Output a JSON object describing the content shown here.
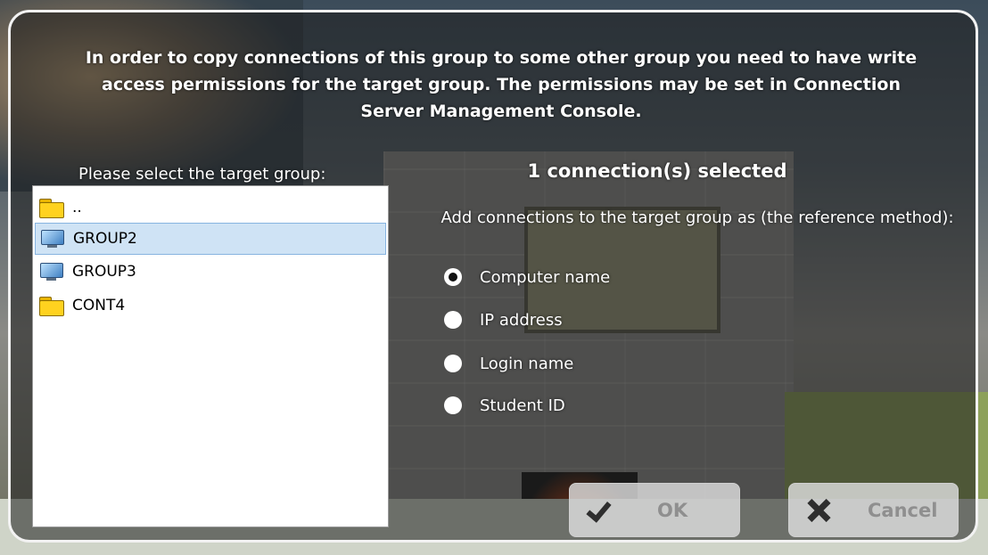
{
  "dialog": {
    "message": "In order to copy connections of this group to some other group you need to have write access permissions for the target group. The permissions may be set in Connection Server Management Console.",
    "select_label": "Please select the target group:",
    "selected_count": "1 connection(s) selected",
    "method_label": "Add connections to the target group as (the reference method):"
  },
  "tree": {
    "items": [
      {
        "label": "..",
        "icon": "folder-icon",
        "selected": false
      },
      {
        "label": "GROUP2",
        "icon": "monitor-icon",
        "selected": true
      },
      {
        "label": "GROUP3",
        "icon": "monitor-icon",
        "selected": false
      },
      {
        "label": "CONT4",
        "icon": "folder-icon",
        "selected": false
      }
    ]
  },
  "reference_methods": {
    "options": [
      "Computer name",
      "IP address",
      "Login name",
      "Student ID"
    ],
    "selected": "Computer name"
  },
  "buttons": {
    "ok_label": "OK",
    "ok_icon": "check-icon",
    "cancel_label": "Cancel",
    "cancel_icon": "x-icon"
  }
}
